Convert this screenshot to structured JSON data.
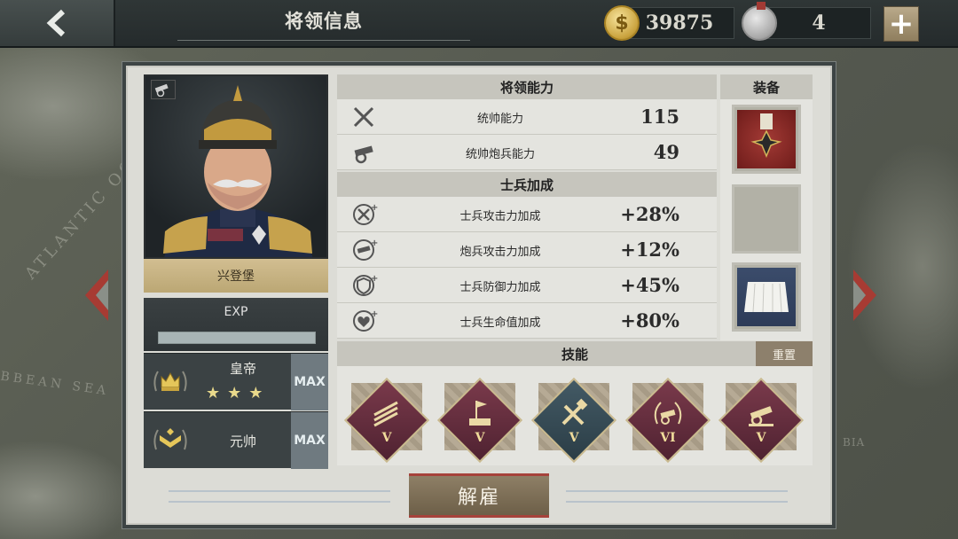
{
  "header": {
    "title": "将领信息",
    "gold": "39875",
    "medals": "4",
    "add_label": "+"
  },
  "general": {
    "name": "兴登堡",
    "exp_label": "EXP",
    "exp_progress": 1.0,
    "rank1": {
      "title": "皇帝",
      "stars": 3,
      "max_label": "MAX"
    },
    "rank2": {
      "title": "元帅",
      "max_label": "MAX"
    }
  },
  "ability": {
    "header": "将领能力",
    "rows": [
      {
        "icon": "crossed-swords-icon",
        "label": "统帅能力",
        "value": "115"
      },
      {
        "icon": "cannon-icon",
        "label": "统帅炮兵能力",
        "value": "49"
      }
    ]
  },
  "bonus": {
    "header": "士兵加成",
    "rows": [
      {
        "icon": "swords-plus-icon",
        "label": "士兵攻击力加成",
        "value": "+28%"
      },
      {
        "icon": "cannon-plus-icon",
        "label": "炮兵攻击力加成",
        "value": "+12%"
      },
      {
        "icon": "shield-plus-icon",
        "label": "士兵防御力加成",
        "value": "+45%"
      },
      {
        "icon": "heart-plus-icon",
        "label": "士兵生命值加成",
        "value": "+80%"
      }
    ]
  },
  "equipment": {
    "header": "装备",
    "slots": [
      "iron-cross-medal",
      "empty",
      "white-kilt"
    ]
  },
  "skills": {
    "header": "技能",
    "reset_label": "重置",
    "items": [
      {
        "icon": "rockets-icon",
        "level": "V",
        "color": "purple"
      },
      {
        "icon": "flag-fort-icon",
        "level": "V",
        "color": "purple"
      },
      {
        "icon": "hammer-wrench-icon",
        "level": "V",
        "color": "teal"
      },
      {
        "icon": "laurel-cannon-icon",
        "level": "VI",
        "color": "purple"
      },
      {
        "icon": "artillery-icon",
        "level": "V",
        "color": "purple"
      }
    ]
  },
  "footer": {
    "dismiss_label": "解雇"
  },
  "map": {
    "label1": "ATLANTIC OCE",
    "label2": "BBEAN SEA",
    "label3": "BIA"
  }
}
